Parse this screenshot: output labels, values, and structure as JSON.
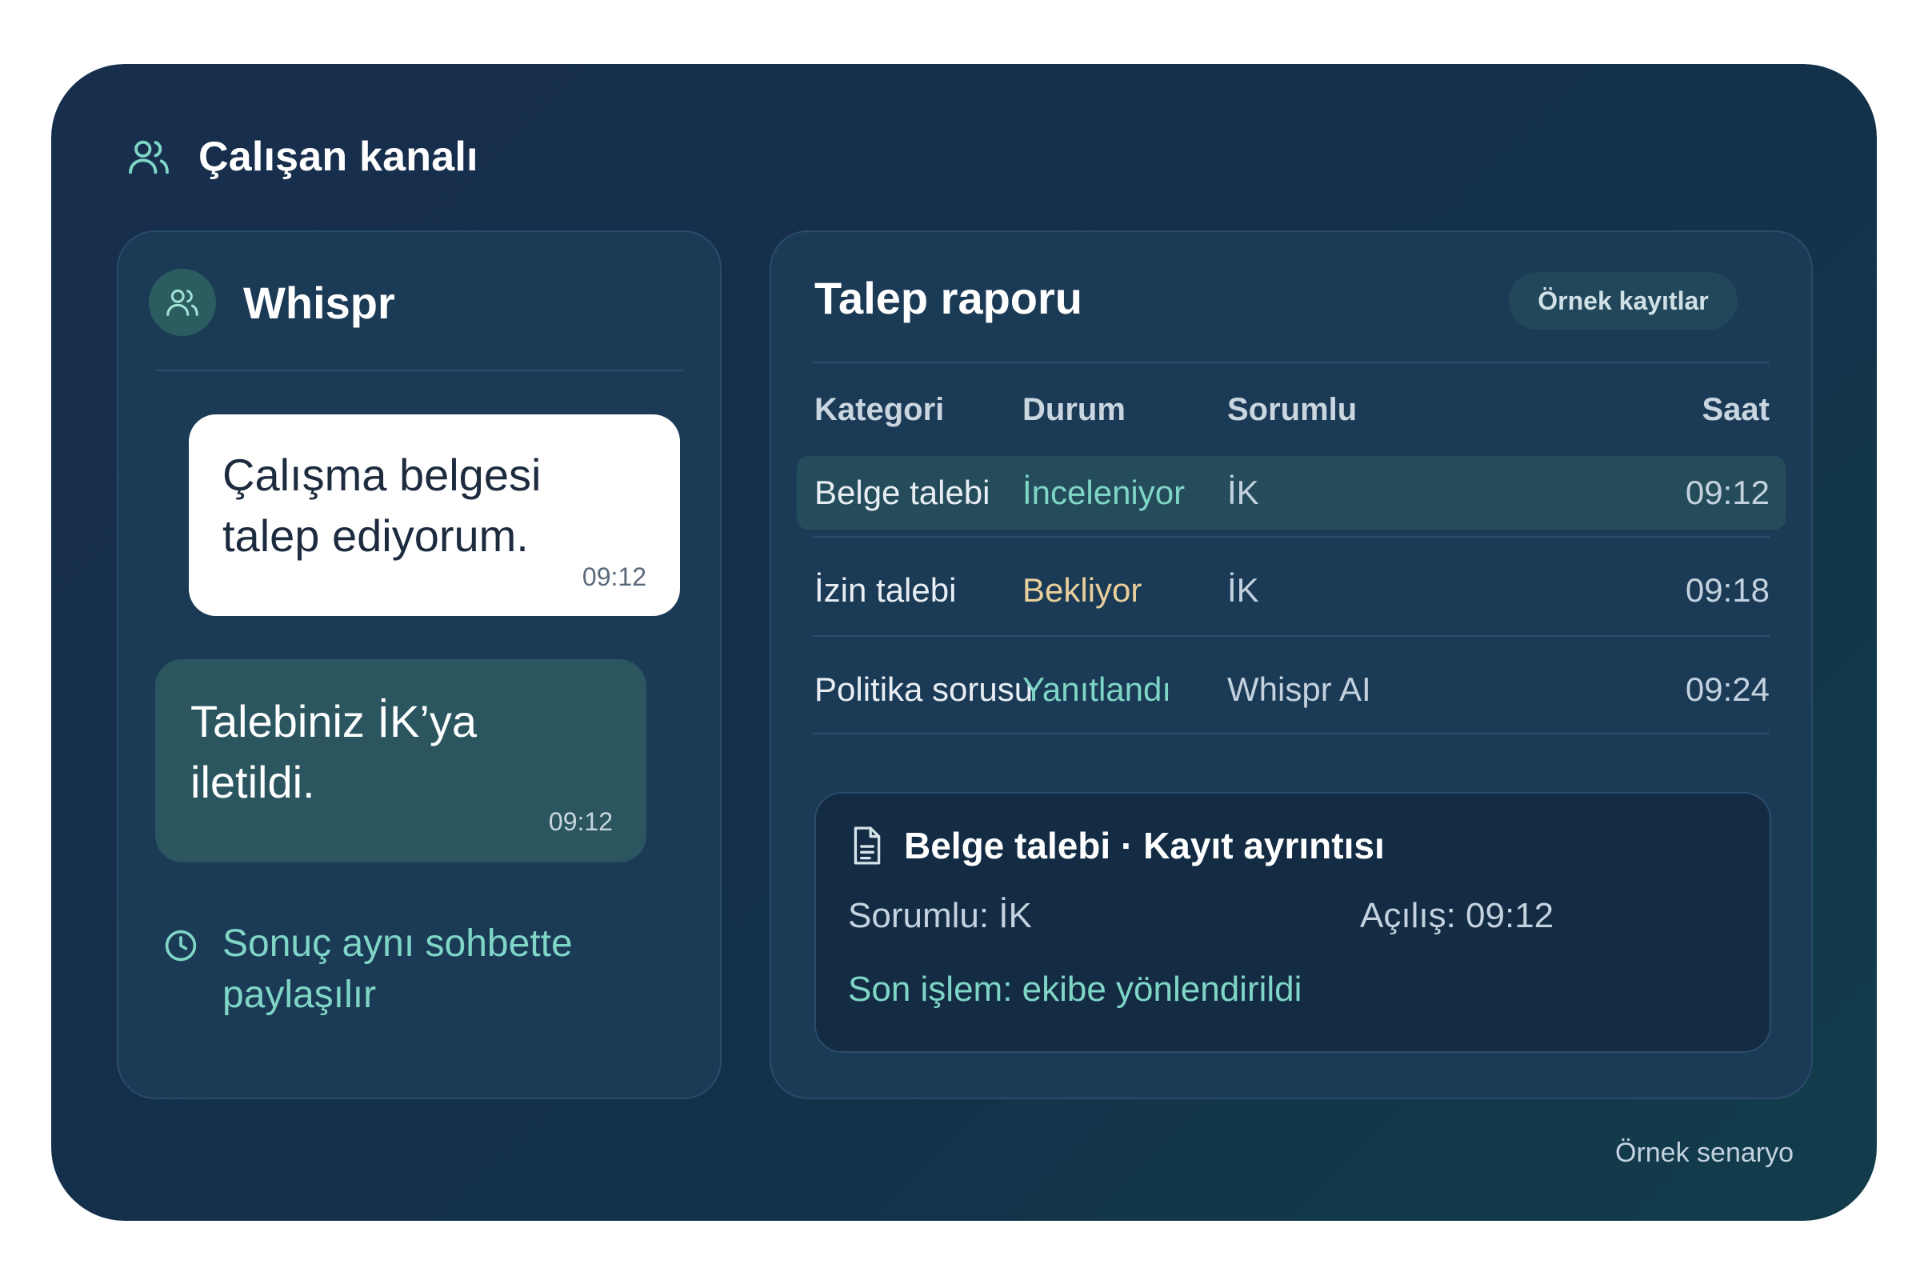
{
  "app": {
    "title": "Çalışan kanalı",
    "footer_note": "Örnek senaryo"
  },
  "chat": {
    "name": "Whispr",
    "messages": [
      {
        "sender": "user",
        "text": "Çalışma belgesi talep ediyorum.",
        "time": "09:12"
      },
      {
        "sender": "bot",
        "text": "Talebiniz İK’ya iletildi.",
        "time": "09:12"
      }
    ],
    "note": "Sonuç aynı sohbette paylaşılır"
  },
  "report": {
    "title": "Talep raporu",
    "badge": "Örnek kayıtlar",
    "columns": [
      "Kategori",
      "Durum",
      "Sorumlu",
      "Saat"
    ],
    "rows": [
      {
        "category": "Belge talebi",
        "status": "İnceleniyor",
        "status_color": "#7fd6c6",
        "owner": "İK",
        "time": "09:12",
        "selected": true
      },
      {
        "category": "İzin talebi",
        "status": "Bekliyor",
        "status_color": "#e9cf9c",
        "owner": "İK",
        "time": "09:18",
        "selected": false
      },
      {
        "category": "Politika sorusu",
        "status": "Yanıtlandı",
        "status_color": "#7fd6c6",
        "owner": "Whispr AI",
        "time": "09:24",
        "selected": false
      }
    ],
    "detail": {
      "title": "Belge talebi · Kayıt ayrıntısı",
      "owner": "Sorumlu: İK",
      "opened": "Açılış: 09:12",
      "last_action": "Son işlem: ekibe yönlendirildi"
    }
  },
  "colors": {
    "accent": "#7fd6c6",
    "pending": "#e9cf9c",
    "background": "#163450"
  },
  "icons": {
    "header": "users-icon",
    "avatar": "users-icon",
    "note": "clock-icon",
    "detail": "document-icon"
  }
}
